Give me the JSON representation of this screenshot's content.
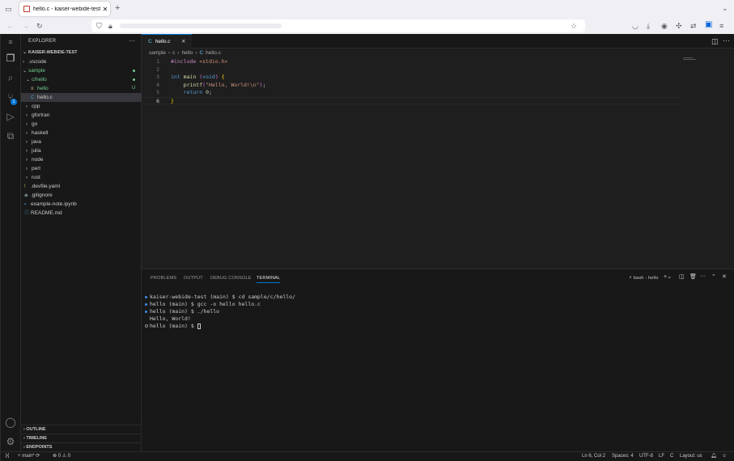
{
  "browser": {
    "tab_title": "hello.c - kaiser-webide-test - I",
    "tab_close": "✕",
    "new_tab": "+",
    "overflow": "⌄"
  },
  "explorer": {
    "header": "EXPLORER",
    "more": "···",
    "root": "KAISER-WEBIDE-TEST",
    "items": [
      {
        "label": ".vscode",
        "chev": "›",
        "icon": "",
        "depth": 1,
        "status": ""
      },
      {
        "label": "sample",
        "chev": "⌄",
        "icon": "",
        "depth": 1,
        "status": "dot",
        "git": true
      },
      {
        "label": "c/hello",
        "chev": "⌄",
        "icon": "",
        "depth": 2,
        "status": "dot",
        "git": true
      },
      {
        "label": "hello",
        "chev": "",
        "icon": "≡",
        "depth": 3,
        "status": "U",
        "git": true
      },
      {
        "label": "hello.c",
        "chev": "",
        "icon": "C",
        "depth": 3,
        "status": "",
        "selected": true
      },
      {
        "label": "cpp",
        "chev": "›",
        "icon": "",
        "depth": 2,
        "status": ""
      },
      {
        "label": "gfortran",
        "chev": "›",
        "icon": "",
        "depth": 2,
        "status": ""
      },
      {
        "label": "go",
        "chev": "›",
        "icon": "",
        "depth": 2,
        "status": ""
      },
      {
        "label": "haskell",
        "chev": "›",
        "icon": "",
        "depth": 2,
        "status": ""
      },
      {
        "label": "java",
        "chev": "›",
        "icon": "",
        "depth": 2,
        "status": ""
      },
      {
        "label": "julia",
        "chev": "›",
        "icon": "",
        "depth": 2,
        "status": ""
      },
      {
        "label": "node",
        "chev": "›",
        "icon": "",
        "depth": 2,
        "status": ""
      },
      {
        "label": "perl",
        "chev": "›",
        "icon": "",
        "depth": 2,
        "status": ""
      },
      {
        "label": "rust",
        "chev": "›",
        "icon": "",
        "depth": 2,
        "status": ""
      },
      {
        "label": ".devfile.yaml",
        "chev": "",
        "icon": "!",
        "depth": 1,
        "status": ""
      },
      {
        "label": ".gitignore",
        "chev": "",
        "icon": "◆",
        "depth": 1,
        "status": ""
      },
      {
        "label": "example-note.ipynb",
        "chev": "",
        "icon": "▪",
        "depth": 1,
        "status": ""
      },
      {
        "label": "README.md",
        "chev": "",
        "icon": "ⓘ",
        "depth": 1,
        "status": ""
      }
    ],
    "sections": [
      "OUTLINE",
      "TIMELINE",
      "ENDPOINTS"
    ]
  },
  "scm_badge": "1",
  "editor": {
    "tab_label": "hello.c",
    "tab_icon": "C",
    "tab_close": "✕",
    "breadcrumb": [
      "sample",
      "›",
      "c",
      "›",
      "hello",
      "›",
      "C",
      "hello.c"
    ]
  },
  "code_lines": [
    {
      "n": "1",
      "t": "#include <stdio.h>"
    },
    {
      "n": "2",
      "t": ""
    },
    {
      "n": "3",
      "t": "int main (void) {"
    },
    {
      "n": "4",
      "t": "    printf(\"Hello, World!\\n\");"
    },
    {
      "n": "5",
      "t": "    return 0;"
    },
    {
      "n": "6",
      "t": "}"
    }
  ],
  "panel": {
    "tabs": [
      "PROBLEMS",
      "OUTPUT",
      "DEBUG CONSOLE",
      "TERMINAL"
    ],
    "terminal_name": "bash - hello",
    "terminal_lines": [
      {
        "dot": "blue",
        "text": "kaiser-webide-test (main) $ cd sample/c/hello/"
      },
      {
        "dot": "blue",
        "text": "hello (main) $ gcc -o hello hello.c"
      },
      {
        "dot": "blue",
        "text": "hello (main) $ ./hello"
      },
      {
        "dot": "",
        "text": "Hello, World!"
      },
      {
        "dot": "hollow",
        "text": "hello (main) $ "
      }
    ]
  },
  "status": {
    "branch": "main*",
    "problems": "⊗ 0 ⚠ 0",
    "position": "Ln 6, Col 2",
    "spaces": "Spaces: 4",
    "encoding": "UTF-8",
    "eol": "LF",
    "language": "C",
    "layout": "Layout: us"
  }
}
